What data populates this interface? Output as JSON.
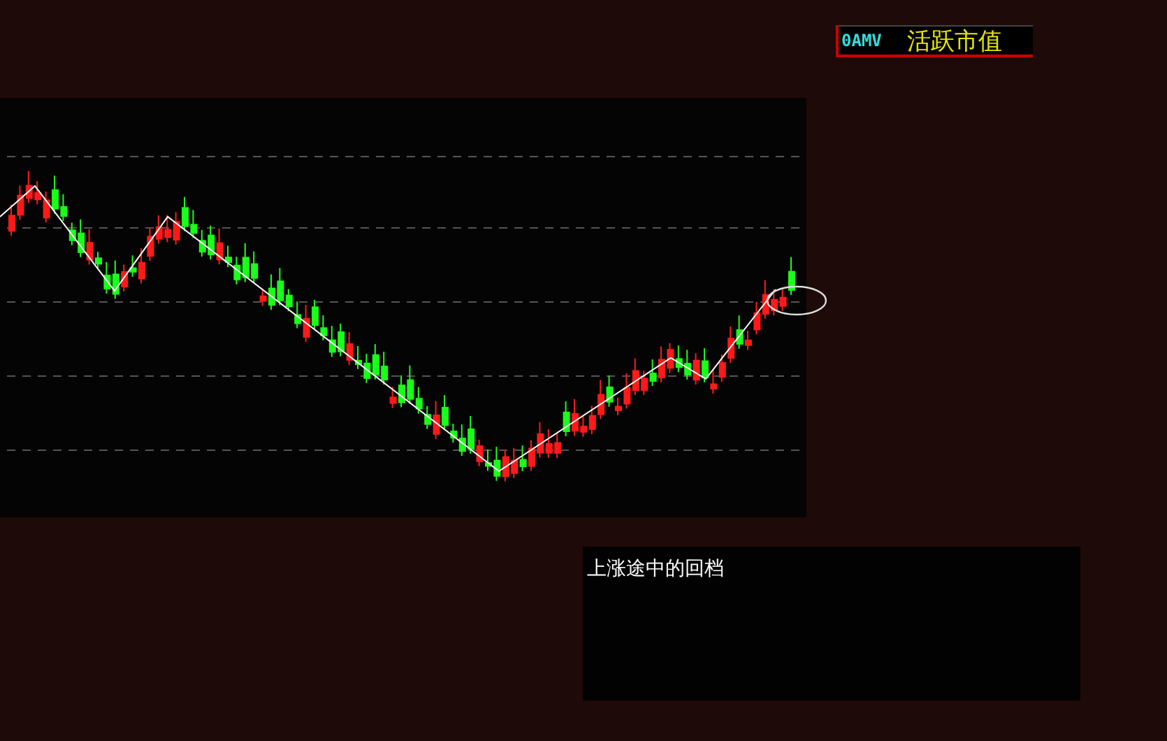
{
  "indicator_legend": {
    "code": "0AMV",
    "name": "活跃市值"
  },
  "note_panel": {
    "text": "上涨途中的回档"
  }
}
